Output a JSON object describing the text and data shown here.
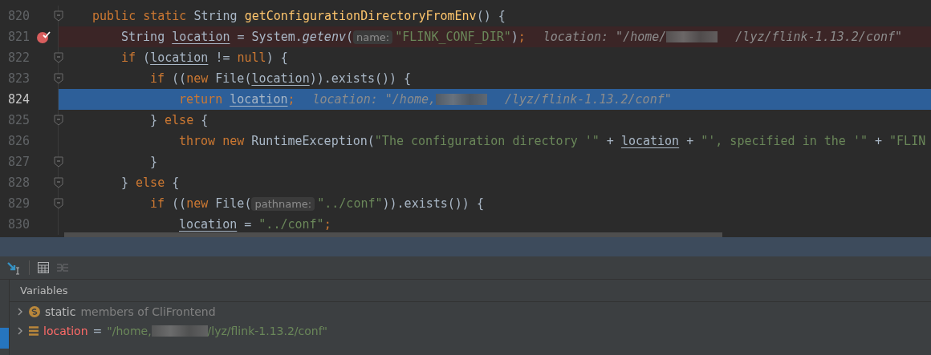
{
  "editor": {
    "lines": [
      {
        "number": "820",
        "fold": true,
        "breakpoint": false,
        "current": false,
        "tokens": [
          {
            "kind": "kw",
            "text": "public static "
          },
          {
            "kind": "plain",
            "text": "String "
          },
          {
            "kind": "decl",
            "text": "getConfigurationDirectoryFromEnv"
          },
          {
            "kind": "plain",
            "text": "() {"
          }
        ],
        "children": [
          {
            "number": "821",
            "fold": false,
            "breakpoint": true,
            "current": false,
            "tokens": [
              {
                "kind": "plain",
                "text": "String "
              },
              {
                "kind": "var",
                "text": "location"
              },
              {
                "kind": "plain",
                "text": " = System."
              },
              {
                "kind": "italic",
                "text": "getenv"
              },
              {
                "kind": "plain",
                "text": "("
              },
              {
                "kind": "param_hint",
                "text": "name:"
              },
              {
                "kind": "str",
                "text": "\"FLINK_CONF_DIR\""
              },
              {
                "kind": "plain",
                "text": ")"
              },
              {
                "kind": "kw",
                "text": ";"
              },
              {
                "kind": "value_hint",
                "text": "location: \"/home/"
              },
              {
                "kind": "redacted"
              },
              {
                "kind": "value_hint",
                "text": "/lyz/flink-1.13.2/conf\""
              }
            ]
          },
          {
            "number": "822",
            "fold": true,
            "breakpoint": false,
            "current": false,
            "tokens": [
              {
                "kind": "kw",
                "text": "if "
              },
              {
                "kind": "plain",
                "text": "("
              },
              {
                "kind": "var",
                "text": "location"
              },
              {
                "kind": "plain",
                "text": " != "
              },
              {
                "kind": "kw",
                "text": "null"
              },
              {
                "kind": "plain",
                "text": ") {"
              }
            ],
            "children": [
              {
                "number": "823",
                "fold": true,
                "breakpoint": false,
                "current": false,
                "tokens": [
                  {
                    "kind": "kw",
                    "text": "if "
                  },
                  {
                    "kind": "plain",
                    "text": "(("
                  },
                  {
                    "kind": "kw",
                    "text": "new "
                  },
                  {
                    "kind": "plain",
                    "text": "File("
                  },
                  {
                    "kind": "var",
                    "text": "location"
                  },
                  {
                    "kind": "plain",
                    "text": ")).exists()) {"
                  }
                ],
                "children": [
                  {
                    "number": "824",
                    "fold": false,
                    "breakpoint": false,
                    "current": true,
                    "tokens": [
                      {
                        "kind": "kw",
                        "text": "return "
                      },
                      {
                        "kind": "var",
                        "text": "location"
                      },
                      {
                        "kind": "kw",
                        "text": ";"
                      },
                      {
                        "kind": "value_hint",
                        "text": "location: \"/home,"
                      },
                      {
                        "kind": "redacted"
                      },
                      {
                        "kind": "value_hint",
                        "text": "/lyz/flink-1.13.2/conf\""
                      }
                    ]
                  }
                ]
              },
              {
                "number": "825",
                "fold": true,
                "breakpoint": false,
                "current": false,
                "tokens": [
                  {
                    "kind": "plain",
                    "text": "} "
                  },
                  {
                    "kind": "kw",
                    "text": "else "
                  },
                  {
                    "kind": "plain",
                    "text": "{"
                  }
                ],
                "children": [
                  {
                    "number": "826",
                    "fold": false,
                    "breakpoint": false,
                    "current": false,
                    "tokens": [
                      {
                        "kind": "kw",
                        "text": "throw new "
                      },
                      {
                        "kind": "plain",
                        "text": "RuntimeException("
                      },
                      {
                        "kind": "str",
                        "text": "\"The configuration directory '\""
                      },
                      {
                        "kind": "plain",
                        "text": " + "
                      },
                      {
                        "kind": "var",
                        "text": "location"
                      },
                      {
                        "kind": "plain",
                        "text": " + "
                      },
                      {
                        "kind": "str",
                        "text": "\"', specified in the '\""
                      },
                      {
                        "kind": "plain",
                        "text": " + "
                      },
                      {
                        "kind": "str",
                        "text": "\"FLIN"
                      }
                    ]
                  }
                ]
              },
              {
                "number": "827",
                "fold": true,
                "breakpoint": false,
                "current": false,
                "tokens": [
                  {
                    "kind": "plain",
                    "text": "}"
                  }
                ]
              }
            ]
          },
          {
            "number": "828",
            "fold": true,
            "breakpoint": false,
            "current": false,
            "tokens": [
              {
                "kind": "plain",
                "text": "} "
              },
              {
                "kind": "kw",
                "text": "else "
              },
              {
                "kind": "plain",
                "text": "{"
              }
            ],
            "children": [
              {
                "number": "829",
                "fold": true,
                "breakpoint": false,
                "current": false,
                "tokens": [
                  {
                    "kind": "kw",
                    "text": "if "
                  },
                  {
                    "kind": "plain",
                    "text": "(("
                  },
                  {
                    "kind": "kw",
                    "text": "new "
                  },
                  {
                    "kind": "plain",
                    "text": "File("
                  },
                  {
                    "kind": "param_hint",
                    "text": "pathname:"
                  },
                  {
                    "kind": "str",
                    "text": "\"../conf\""
                  },
                  {
                    "kind": "plain",
                    "text": ")).exists()) {"
                  }
                ],
                "children": [
                  {
                    "number": "830",
                    "fold": false,
                    "breakpoint": false,
                    "current": false,
                    "tokens": [
                      {
                        "kind": "var",
                        "text": "location"
                      },
                      {
                        "kind": "plain",
                        "text": " = "
                      },
                      {
                        "kind": "str",
                        "text": "\"../conf\""
                      },
                      {
                        "kind": "kw",
                        "text": ";"
                      }
                    ]
                  }
                ]
              }
            ]
          }
        ]
      }
    ]
  },
  "variables": {
    "title": "Variables",
    "rows": [
      {
        "kind": "static",
        "expanded": false,
        "name": "static",
        "detail": "members of CliFrontend"
      },
      {
        "kind": "field",
        "expanded": false,
        "name": "location",
        "separator": "=",
        "value": "\"/home,",
        "value_rest": "/lyz/flink-1.13.2/conf\""
      }
    ]
  }
}
